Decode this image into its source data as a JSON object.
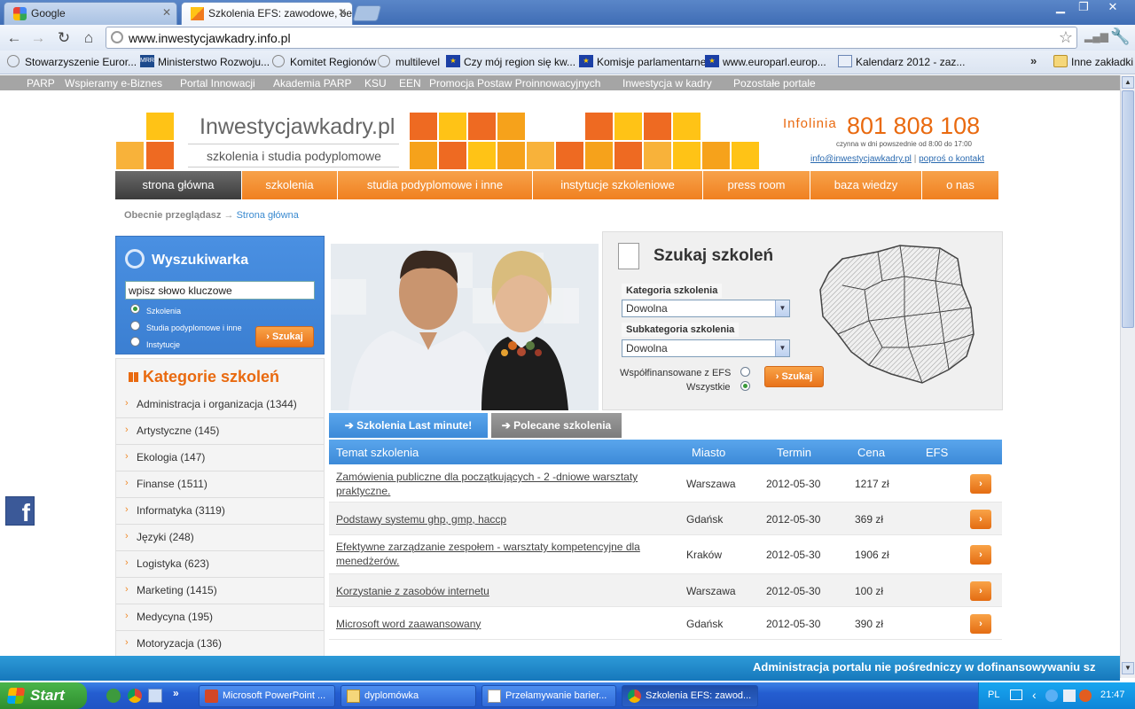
{
  "browser": {
    "tabs": [
      {
        "title": "Google",
        "active": false
      },
      {
        "title": "Szkolenia EFS: zawodowe, bez",
        "active": true
      }
    ],
    "url": "www.inwestycjawkadry.info.pl",
    "bookmarks": [
      "Stowarzyszenie Euror...",
      "Ministerstwo Rozwoju...",
      "Komitet Regionów",
      "multilevel",
      "Czy mój region się kw...",
      "Komisje parlamentarne",
      "www.europarl.europ...",
      "Kalendarz 2012 - zaz...",
      "Inne zakładki"
    ]
  },
  "site": {
    "toplinks": [
      "PARP",
      "Wspieramy e-Biznes",
      "Portal Innowacji",
      "Akademia PARP",
      "KSU",
      "EEN",
      "Promocja Postaw Proinnowacyjnych",
      "Inwestycja w kadry",
      "Pozostałe portale"
    ],
    "logo_title": "Inwestycjawkadry.pl",
    "logo_sub": "szkolenia i studia podyplomowe",
    "infolinia_label": "Infolinia",
    "infolinia_number": "801 808 108",
    "infolinia_hours": "czynna w dni powszednie od 8:00 do 17:00",
    "email": "info@inwestycjawkadry.pl",
    "contact": "poproś o kontakt",
    "nav": [
      "strona główna",
      "szkolenia",
      "studia podyplomowe i inne",
      "instytucje szkoleniowe",
      "press room",
      "baza wiedzy",
      "o nas"
    ],
    "breadcrumb_label": "Obecnie przeglądasz",
    "breadcrumb_page": "Strona główna"
  },
  "search": {
    "title": "Wyszukiwarka",
    "input_value": "wpisz słowo kluczowe",
    "options": [
      "Szkolenia",
      "Studia podyplomowe i inne",
      "Instytucje"
    ],
    "button": "Szukaj"
  },
  "categories": {
    "title": "Kategorie szkoleń",
    "items": [
      "Administracja i organizacja (1344)",
      "Artystyczne (145)",
      "Ekologia (147)",
      "Finanse (1511)",
      "Informatyka (3119)",
      "Języki (248)",
      "Logistyka (623)",
      "Marketing (1415)",
      "Medycyna (195)",
      "Motoryzacja (136)"
    ]
  },
  "szukaj": {
    "title": "Szukaj szkoleń",
    "kategoria_label": "Kategoria szkolenia",
    "kategoria_value": "Dowolna",
    "subkategoria_label": "Subkategoria szkolenia",
    "subkategoria_value": "Dowolna",
    "efs_label": "Współfinansowane z EFS",
    "all_label": "Wszystkie",
    "button": "Szukaj"
  },
  "trainings": {
    "tab_last_minute": "Szkolenia Last minute!",
    "tab_polecane": "Polecane szkolenia",
    "headers": [
      "Temat szkolenia",
      "Miasto",
      "Termin",
      "Cena",
      "EFS"
    ],
    "rows": [
      {
        "title": "Zamówienia publiczne dla początkujących - 2 -dniowe warsztaty praktyczne.",
        "city": "Warszawa",
        "date": "2012-05-30",
        "price": "1217 zł"
      },
      {
        "title": "Podstawy systemu ghp, gmp, haccp",
        "city": "Gdańsk",
        "date": "2012-05-30",
        "price": "369 zł"
      },
      {
        "title": "Efektywne zarządzanie zespołem - warsztaty kompetencyjne dla menedżerów.",
        "city": "Kraków",
        "date": "2012-05-30",
        "price": "1906 zł"
      },
      {
        "title": "Korzystanie z zasobów internetu",
        "city": "Warszawa",
        "date": "2012-05-30",
        "price": "100 zł"
      },
      {
        "title": "Microsoft word zaawansowany",
        "city": "Gdańsk",
        "date": "2012-05-30",
        "price": "390 zł"
      }
    ]
  },
  "notice": "Administracja portalu nie pośredniczy w dofinansowywaniu sz",
  "taskbar": {
    "start": "Start",
    "tasks": [
      "Microsoft PowerPoint ...",
      "dyplomówka",
      "Przełamywanie barier...",
      "Szkolenia EFS: zawod..."
    ],
    "lang": "PL",
    "time": "21:47"
  },
  "colors": {
    "accent_orange": "#f08020",
    "accent_blue": "#3c8ad8",
    "tile_yellow": "#ffc316"
  }
}
